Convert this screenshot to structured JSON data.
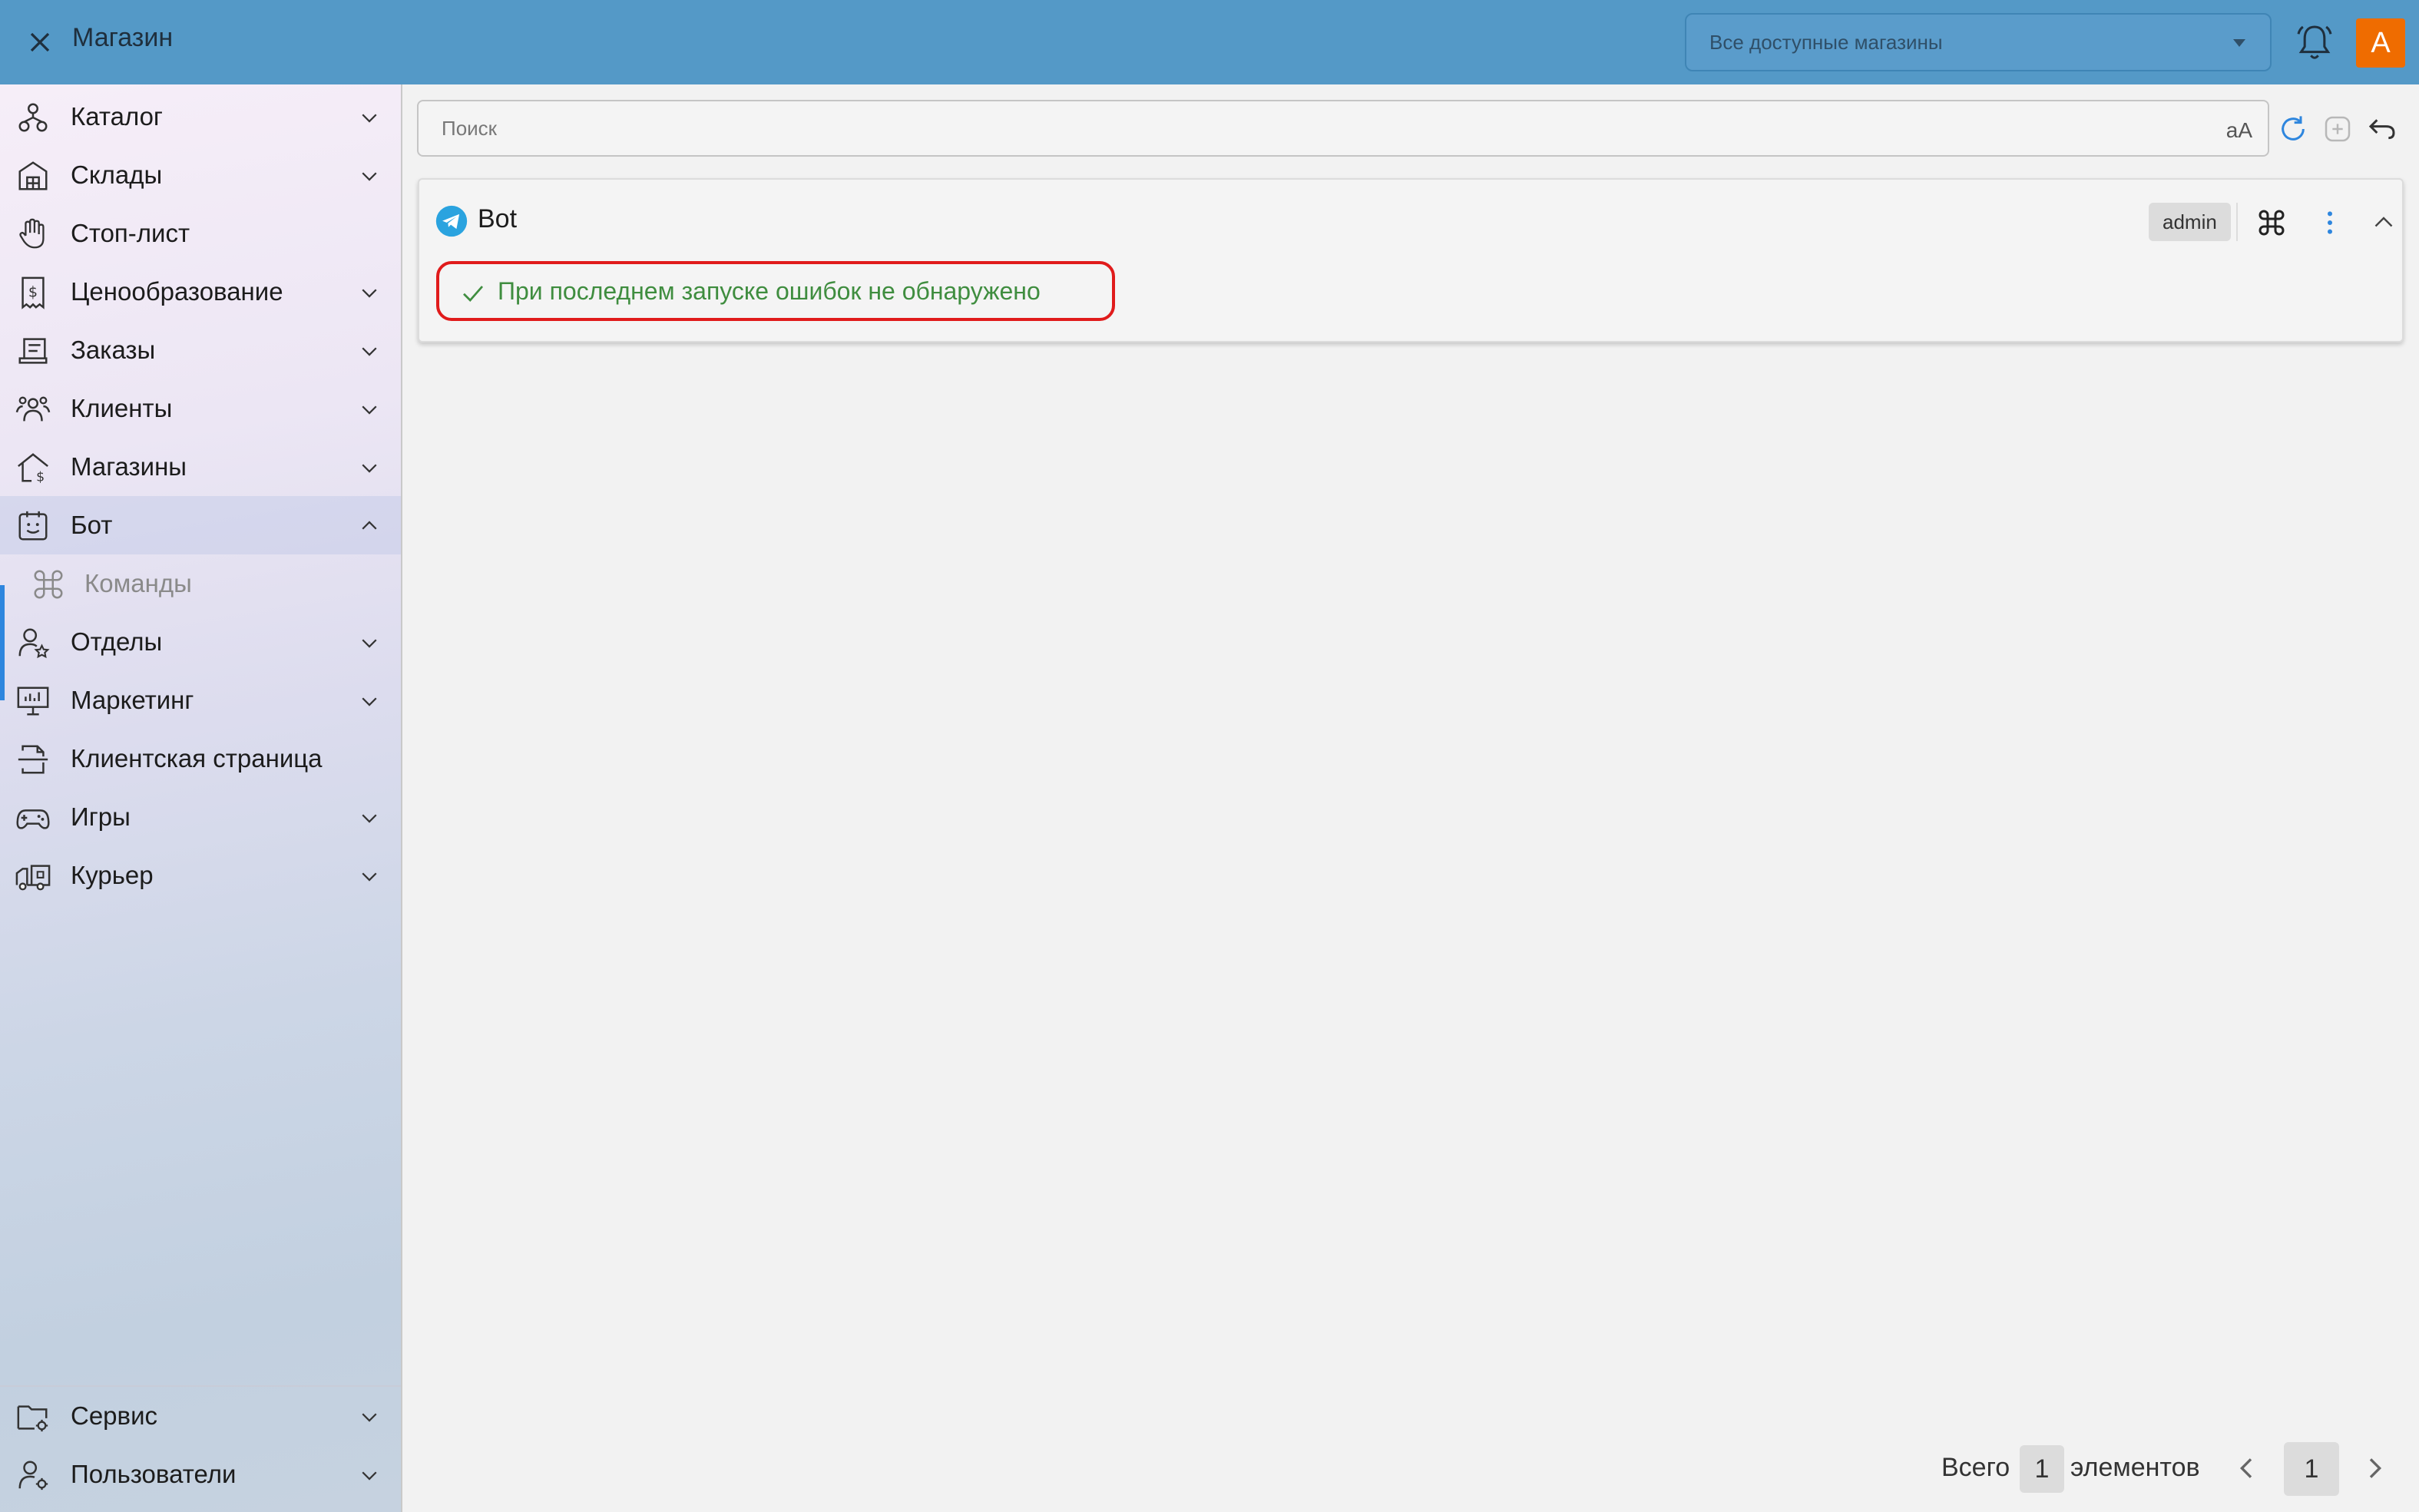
{
  "topbar": {
    "title": "Магазин",
    "store_select_value": "Все доступные магазины",
    "avatar_letter": "А",
    "bg_color": "#5499c7",
    "avatar_color": "#ef6c00"
  },
  "sidebar": {
    "items": [
      {
        "label": "Каталог",
        "icon": "catalog-icon",
        "expandable": true
      },
      {
        "label": "Склады",
        "icon": "warehouse-icon",
        "expandable": true
      },
      {
        "label": "Стоп-лист",
        "icon": "hand-stop-icon",
        "expandable": false
      },
      {
        "label": "Ценообразование",
        "icon": "price-receipt-icon",
        "expandable": true
      },
      {
        "label": "Заказы",
        "icon": "orders-icon",
        "expandable": true
      },
      {
        "label": "Клиенты",
        "icon": "clients-icon",
        "expandable": true
      },
      {
        "label": "Магазины",
        "icon": "store-icon",
        "expandable": true
      },
      {
        "label": "Бот",
        "icon": "bot-icon",
        "expandable": true,
        "expanded": true,
        "active": true
      },
      {
        "label": "Команды",
        "icon": "command-icon",
        "sub": true
      },
      {
        "label": "Отделы",
        "icon": "department-icon",
        "expandable": true
      },
      {
        "label": "Маркетинг",
        "icon": "marketing-icon",
        "expandable": true
      },
      {
        "label": "Клиентская страница",
        "icon": "client-page-icon",
        "expandable": false
      },
      {
        "label": "Игры",
        "icon": "gamepad-icon",
        "expandable": true
      },
      {
        "label": "Курьер",
        "icon": "courier-truck-icon",
        "expandable": true
      }
    ],
    "bottom_items": [
      {
        "label": "Сервис",
        "icon": "service-folder-icon"
      },
      {
        "label": "Пользователи",
        "icon": "users-gear-icon"
      }
    ],
    "accent_color": "#2e86de"
  },
  "search": {
    "placeholder": "Поиск",
    "value": "",
    "case_toggle": "aA"
  },
  "card": {
    "title": "Bot",
    "badge": "admin",
    "status_message": "При последнем запуске ошибок не обнаружено",
    "status_color": "#3f8d3f",
    "highlight_color": "#e01b1b"
  },
  "pagination": {
    "total_label": "Всего",
    "total_count": "1",
    "elements_label": "элементов",
    "current_page": "1"
  }
}
